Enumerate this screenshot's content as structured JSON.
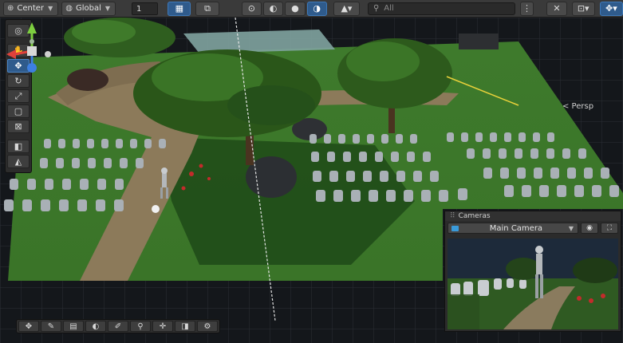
{
  "toolbar": {
    "pivot_label": "Center",
    "space_label": "Global",
    "grid_value": "1",
    "search_placeholder": "All",
    "icons": [
      "center-icon",
      "global-icon",
      "grid-icon",
      "snap-icon",
      "light-icon",
      "audio-icon",
      "effects-icon",
      "draw-mode-icon",
      "scene-visibility-icon",
      "tools-icon",
      "gizmos-icon"
    ]
  },
  "palette": {
    "tools": [
      "view",
      "hand",
      "move",
      "rotate",
      "scale",
      "rect",
      "transform",
      "custom-editor",
      "custom-2"
    ]
  },
  "gizmo": {
    "projection_label": "< Persp",
    "axis_colors": {
      "x": "#e0413b",
      "y": "#7ccd3f",
      "z": "#3d7fe0"
    }
  },
  "overlay_toolbar": {
    "tools": [
      "move",
      "paint",
      "tiles",
      "rotate",
      "brush",
      "zoom",
      "crosshair",
      "layers",
      "settings"
    ]
  },
  "cameras": {
    "title": "Cameras",
    "selected_camera": "Main Camera"
  },
  "colors": {
    "accent": "#2f5b8c",
    "grass": "#3f7a2a",
    "path": "#8c7a5a"
  }
}
